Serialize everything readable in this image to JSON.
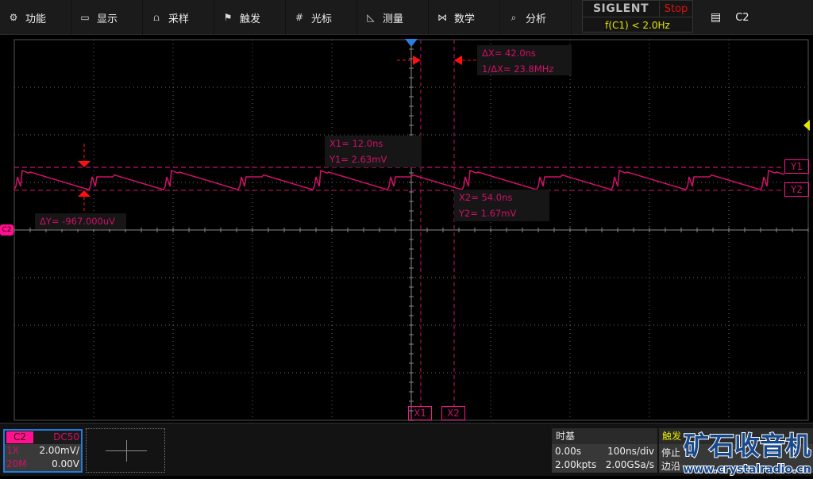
{
  "menu": [
    {
      "label": "功能",
      "icon": "gear-icon",
      "glyph": "⚙"
    },
    {
      "label": "显示",
      "icon": "monitor-icon",
      "glyph": "▭"
    },
    {
      "label": "采样",
      "icon": "acquire-icon",
      "glyph": "⩍"
    },
    {
      "label": "触发",
      "icon": "flag-icon",
      "glyph": "⚑"
    },
    {
      "label": "光标",
      "icon": "cursor-grid-icon",
      "glyph": "#"
    },
    {
      "label": "测量",
      "icon": "measure-triangle-icon",
      "glyph": "◺"
    },
    {
      "label": "数学",
      "icon": "math-icon",
      "glyph": "⋈"
    },
    {
      "label": "分析",
      "icon": "analysis-icon",
      "glyph": "⌕"
    }
  ],
  "brand": {
    "logo": "SIGLENT",
    "status": "Stop",
    "frequency": "f(C1) < 2.0Hz"
  },
  "channel_selector": {
    "icon": "memory-icon",
    "label": "C2"
  },
  "cursors": {
    "dx": "ΔX= 42.0ns",
    "inv_dx": "1/ΔX= 23.8MHz",
    "x1": "X1= 12.0ns",
    "y1": "Y1= 2.63mV",
    "x2": "X2= 54.0ns",
    "y2": "Y2= 1.67mV",
    "dy": "ΔY= -967.000uV",
    "tags": {
      "x1": "X1",
      "x2": "X2",
      "y1": "Y1",
      "y2": "Y2"
    }
  },
  "channel": {
    "name": "C2",
    "coupling": "DC50",
    "probe": "1X",
    "scale": "2.00mV/",
    "bandwidth": "20M",
    "offset": "0.00V",
    "ground_marker": "C2"
  },
  "timebase": {
    "title": "时基",
    "delay": "0.00s",
    "scale": "100ns/div",
    "points": "2.00kpts",
    "rate": "2.00GSa/s"
  },
  "trigger": {
    "title": "触发",
    "state": "停止",
    "type": "边沿"
  },
  "watermark": {
    "title": "矿石收音机",
    "url": "www.crystalradio.cn"
  },
  "colors": {
    "channel2": "#d0106a",
    "cursor": "#ff1090",
    "trigger_level": "#e6e600",
    "trigger_pos": "#2a7fe0",
    "marker": "#ff1010"
  }
}
